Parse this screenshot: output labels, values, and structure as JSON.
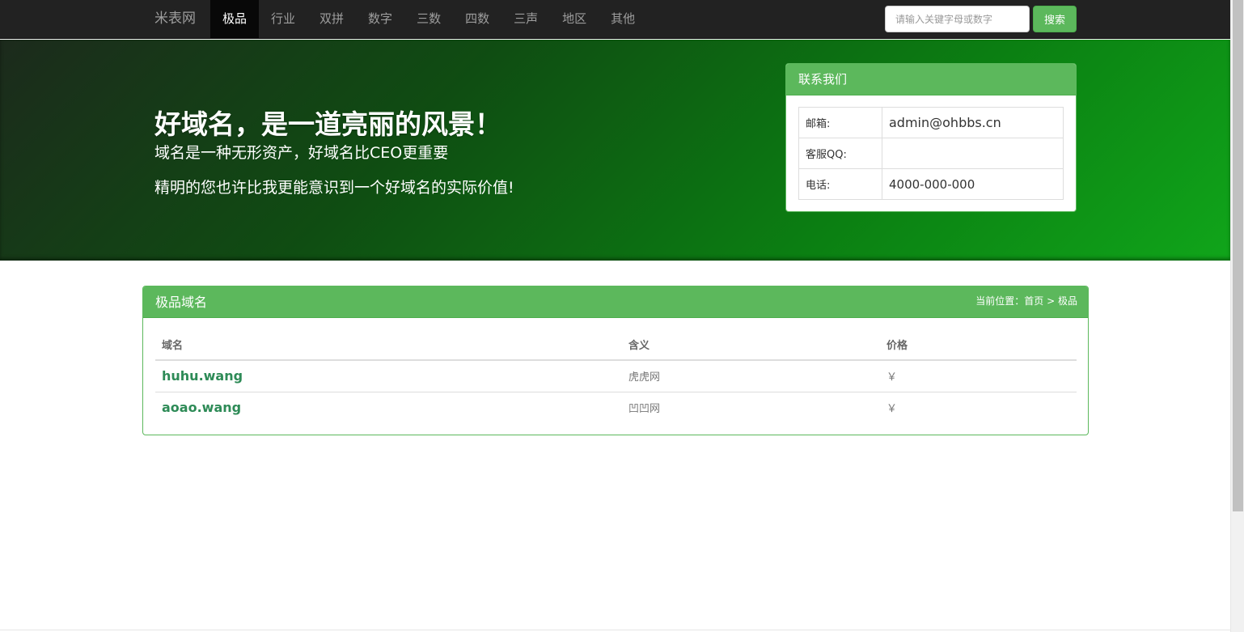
{
  "navbar": {
    "brand": "米表网",
    "items": [
      {
        "label": "极品",
        "active": true
      },
      {
        "label": "行业"
      },
      {
        "label": "双拼"
      },
      {
        "label": "数字"
      },
      {
        "label": "三数"
      },
      {
        "label": "四数"
      },
      {
        "label": "三声"
      },
      {
        "label": "地区"
      },
      {
        "label": "其他"
      }
    ],
    "search": {
      "placeholder": "请输入关键字母或数字",
      "value": "",
      "button_label": "搜索"
    }
  },
  "hero": {
    "title": "好域名，是一道亮丽的风景！",
    "subtitle": "域名是一种无形资产，好域名比CEO更重要",
    "subtitle2": "精明的您也许比我更能意识到一个好域名的实际价值!"
  },
  "contact": {
    "title": "联系我们",
    "rows": [
      {
        "key": "邮箱:",
        "value": "admin@ohbbs.cn"
      },
      {
        "key": "客服QQ:",
        "value": ""
      },
      {
        "key": "电话:",
        "value": "4000-000-000"
      }
    ]
  },
  "domains": {
    "title": "极品域名",
    "breadcrumb": {
      "prefix": "当前位置：",
      "home": "首页",
      "separator": ">",
      "current": "极品"
    },
    "columns": [
      "域名",
      "含义",
      "价格"
    ],
    "rows": [
      {
        "domain": "huhu.wang",
        "meaning": "虎虎网",
        "price": "￥"
      },
      {
        "domain": "aoao.wang",
        "meaning": "凹凹网",
        "price": "￥"
      }
    ]
  },
  "colors": {
    "navbar_bg": "#222222",
    "accent_green": "#5cb85c",
    "link_green": "#2e8b57"
  }
}
